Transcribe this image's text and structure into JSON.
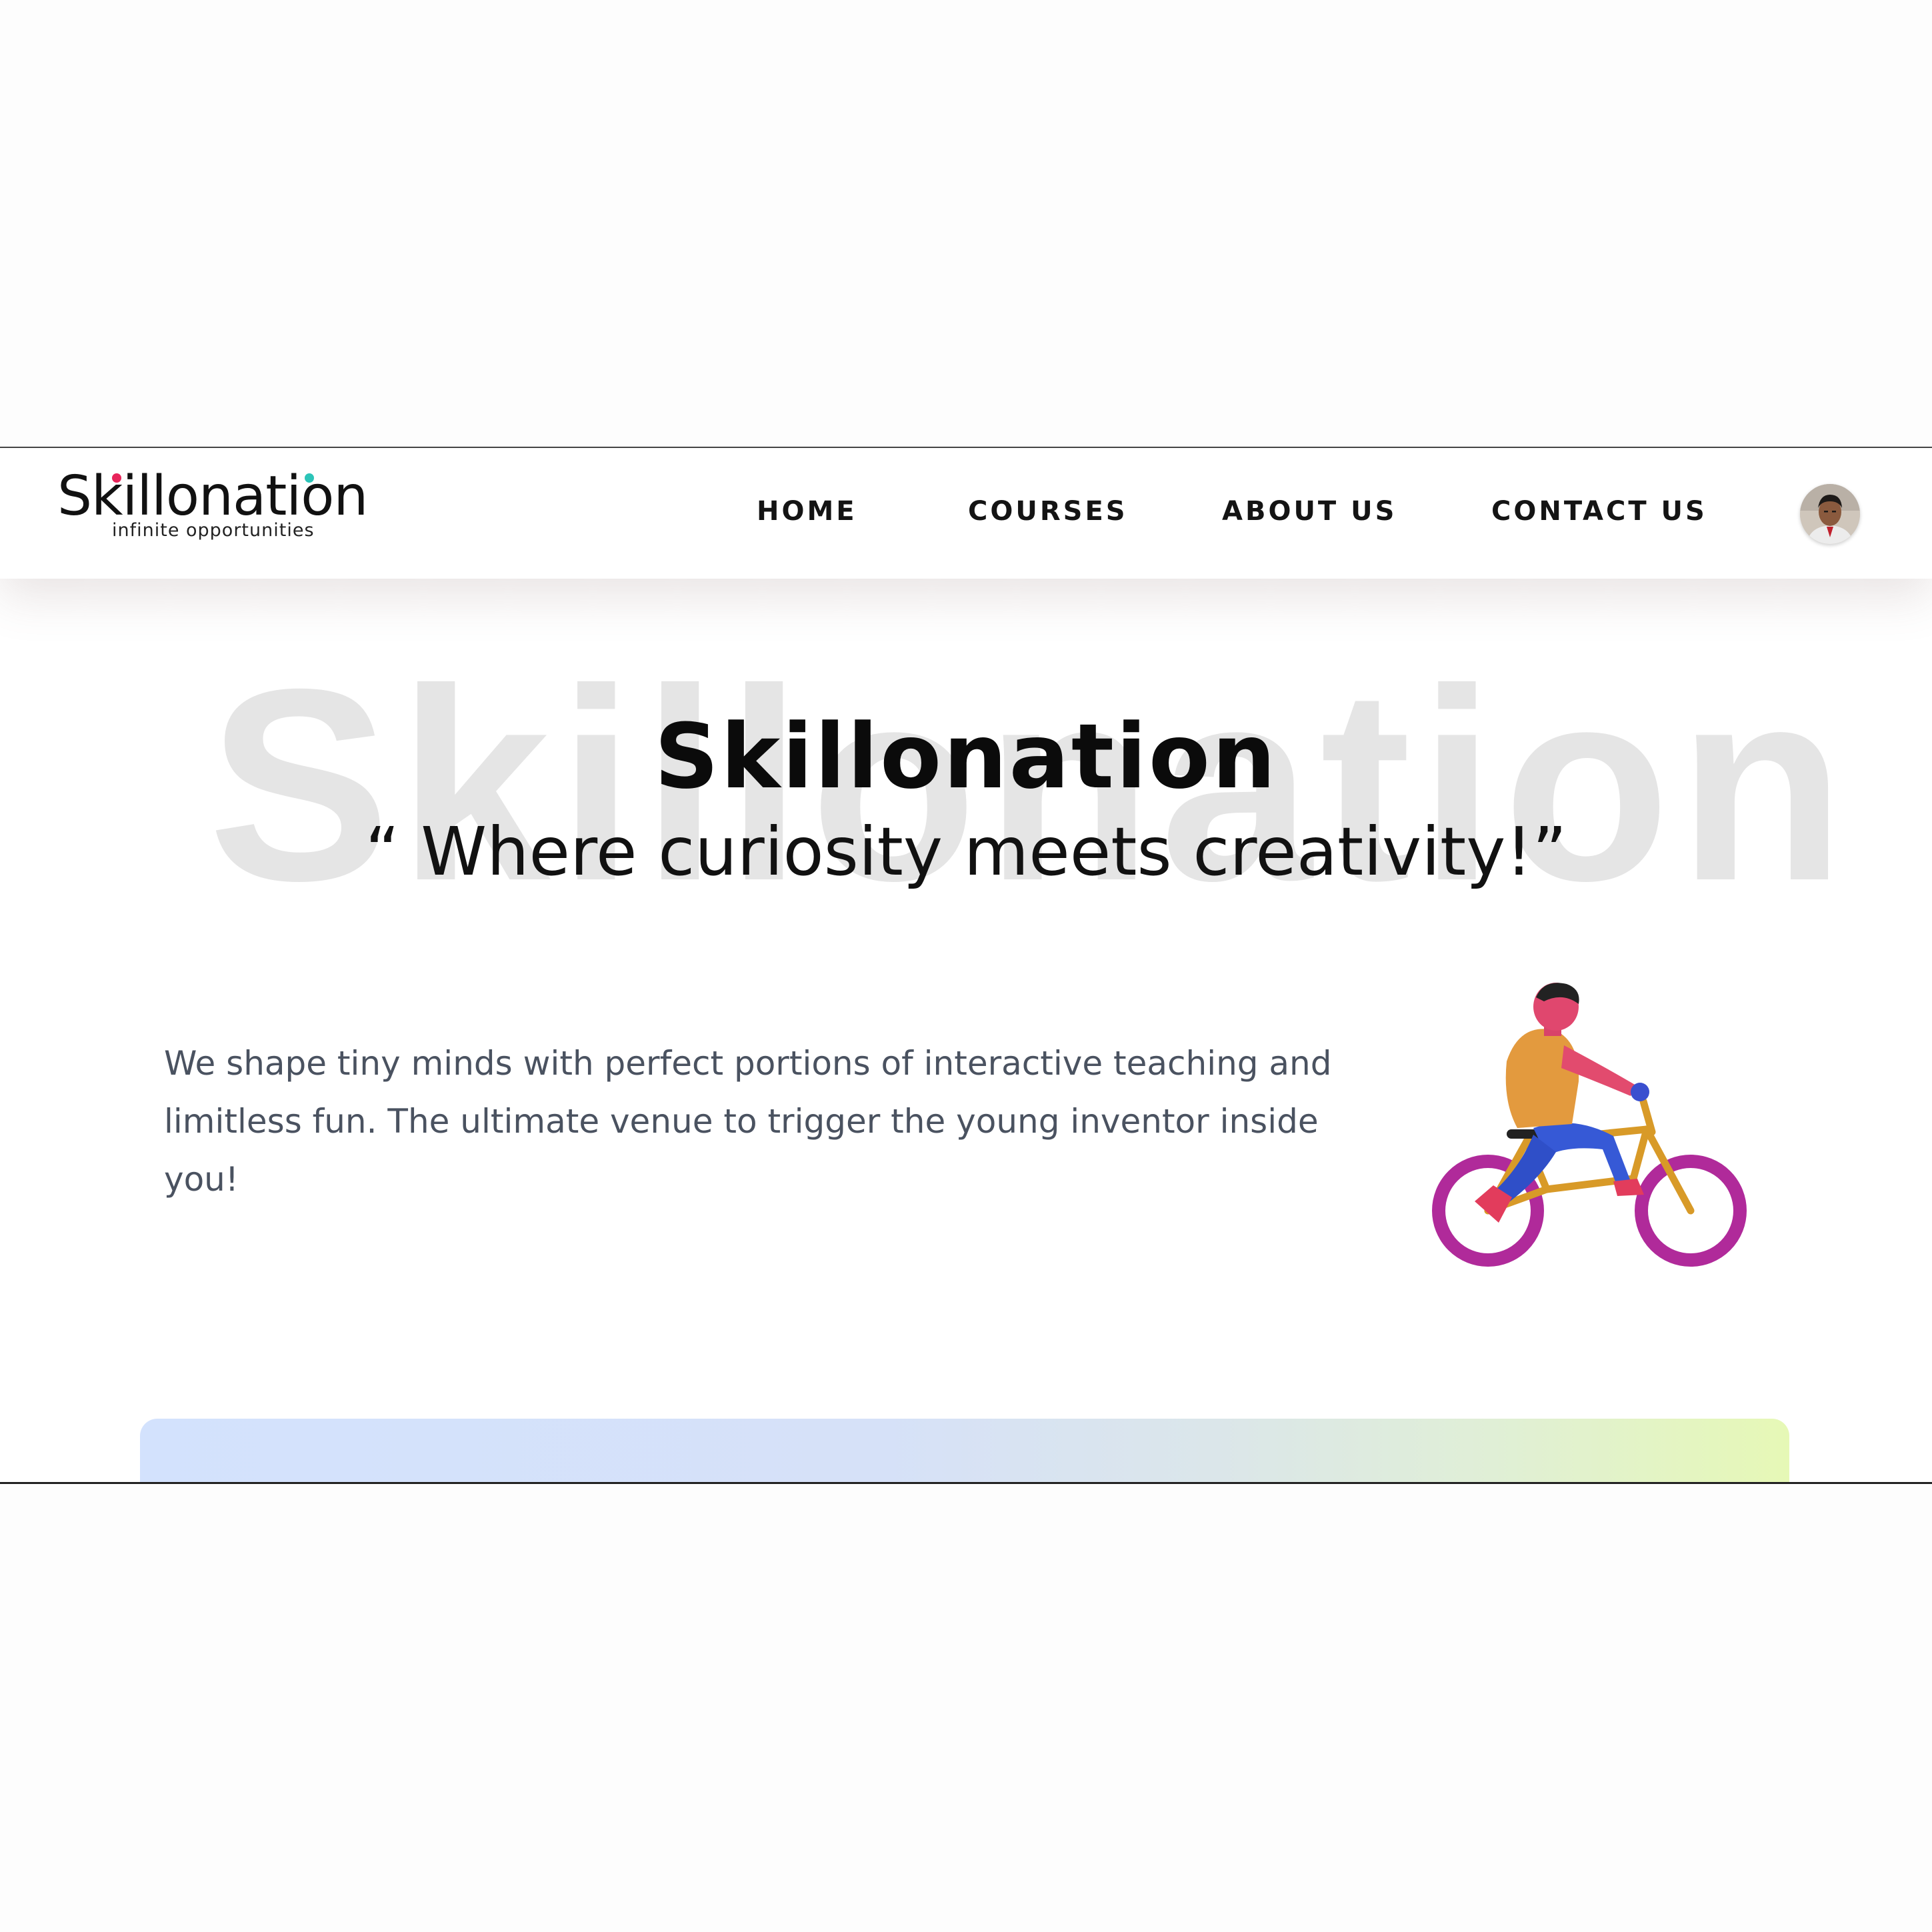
{
  "brand": {
    "logo_text": "Skillonation",
    "logo_tagline": "infinite opportunities"
  },
  "nav": {
    "items": [
      {
        "label": "HOME"
      },
      {
        "label": "COURSES"
      },
      {
        "label": "ABOUT US"
      },
      {
        "label": "CONTACT US"
      }
    ],
    "avatar_icon": "user-avatar-photo"
  },
  "hero": {
    "background_word": "Skillonation",
    "title": "Skillonation",
    "tagline": "“ Where curiosity meets creativity!”",
    "description": "We shape tiny minds with perfect portions of interactive teaching and limitless fun. The ultimate venue to trigger the young inventor inside you!",
    "illustration": "cyclist-illustration-icon"
  },
  "colors": {
    "accent_pink": "#e8245a",
    "accent_teal": "#2cc4b8",
    "text_dark": "#0b0b0b",
    "text_muted": "#4a5260",
    "watermark": "#e5e5e5",
    "card_gradient_start": "#d3e2fd",
    "card_gradient_end": "#e6f8b6"
  }
}
